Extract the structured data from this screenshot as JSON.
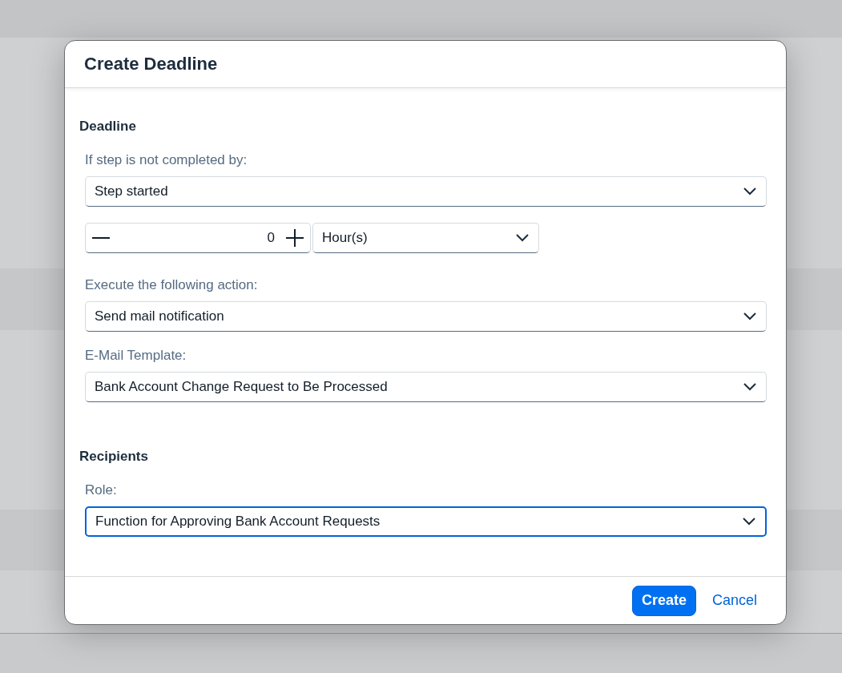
{
  "dialog": {
    "title": "Create Deadline",
    "sections": [
      {
        "title": "Deadline",
        "fields": [
          {
            "kind": "select",
            "label": "If step is not completed by:",
            "value": "Step started",
            "focused": false
          },
          {
            "kind": "stepper",
            "value": "0",
            "unit": "Hour(s)"
          },
          {
            "kind": "select",
            "label": "Execute the following action:",
            "value": "Send mail notification",
            "focused": false
          },
          {
            "kind": "select",
            "label": "E-Mail Template:",
            "value": "Bank Account Change Request to Be Processed",
            "focused": false
          }
        ]
      },
      {
        "title": "Recipients",
        "fields": [
          {
            "kind": "select",
            "label": "Role:",
            "value": "Function for Approving Bank Account Requests",
            "focused": true
          }
        ]
      }
    ],
    "buttons": [
      {
        "label": "Create",
        "kind": "primary"
      },
      {
        "label": "Cancel",
        "kind": "link"
      }
    ]
  }
}
